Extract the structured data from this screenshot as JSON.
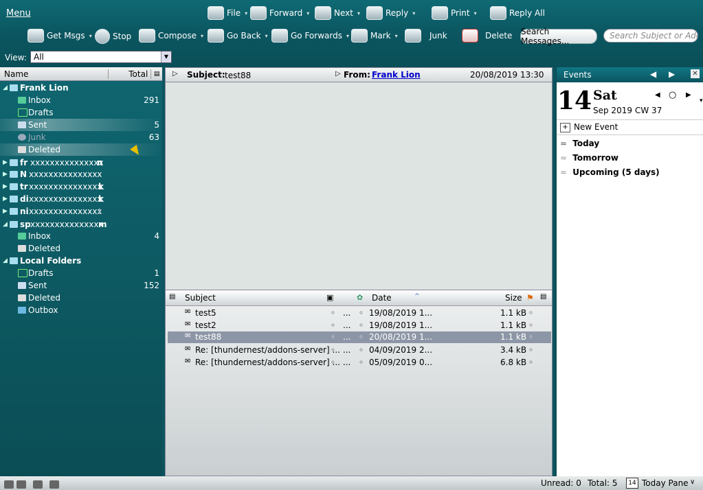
{
  "toolbar": {
    "menu": "Menu",
    "file": "File",
    "forward": "Forward",
    "next": "Next",
    "reply": "Reply",
    "print": "Print",
    "reply_all": "Reply All",
    "get_msgs": "Get Msgs",
    "stop": "Stop",
    "compose": "Compose",
    "go_back": "Go Back",
    "go_forwards": "Go Forwards",
    "mark": "Mark",
    "junk": "Junk",
    "delete": "Delete",
    "search_messages": "Search Messages...",
    "search_placeholder": "Search Subject or Address"
  },
  "view": {
    "label": "View:",
    "value": "All"
  },
  "folder_pane": {
    "header_name": "Name",
    "header_total": "Total",
    "folders": [
      {
        "name": "Frank Lion",
        "count": ""
      },
      {
        "name": "Inbox",
        "count": "291"
      },
      {
        "name": "Drafts",
        "count": ""
      },
      {
        "name": "Sent",
        "count": "5"
      },
      {
        "name": "Junk",
        "count": "63"
      },
      {
        "name": "Deleted",
        "count": ""
      },
      {
        "name": "xxxxxxxxxxxxxxx",
        "count": ""
      },
      {
        "name": "xxxxxxxxxxxxxxx",
        "count": ""
      },
      {
        "name": "xxxxxxxxxxxxxxx",
        "count": ""
      },
      {
        "name": "xxxxxxxxxxxxxxx",
        "count": ""
      },
      {
        "name": "xxxxxxxxxxxxxxx",
        "count": ""
      },
      {
        "name": "xxxxxxxxxxxxxxx",
        "count": ""
      },
      {
        "name": "Inbox",
        "count": "4"
      },
      {
        "name": "Deleted",
        "count": ""
      },
      {
        "name": "Local Folders",
        "count": ""
      },
      {
        "name": "Drafts",
        "count": "1"
      },
      {
        "name": "Sent",
        "count": "152"
      },
      {
        "name": "Deleted",
        "count": ""
      },
      {
        "name": "Outbox",
        "count": ""
      }
    ],
    "account_prefixes": [
      "fr",
      "N",
      "tr",
      "di",
      "ni",
      "sp"
    ],
    "account_suffixes": [
      "n",
      "",
      "k",
      "k",
      "t",
      "m"
    ]
  },
  "message_header": {
    "subject_label": "Subject:",
    "subject": "test88",
    "from_label": "From:",
    "from": "Frank Lion",
    "date": "20/08/2019 13:30"
  },
  "thread_pane": {
    "columns": {
      "subject": "Subject",
      "date": "Date",
      "size": "Size"
    },
    "rows": [
      {
        "subject": "test5",
        "date": "19/08/2019 1...",
        "size": "1.1 kB"
      },
      {
        "subject": "test2",
        "date": "19/08/2019 1...",
        "size": "1.1 kB"
      },
      {
        "subject": "test88",
        "date": "20/08/2019 1...",
        "size": "1.1 kB"
      },
      {
        "subject": "Re: [thundernest/addons-server] ...",
        "date": "04/09/2019 2...",
        "size": "3.4 kB"
      },
      {
        "subject": "Re: [thundernest/addons-server] ...",
        "date": "05/09/2019 0...",
        "size": "6.8 kB"
      }
    ],
    "dots": "..."
  },
  "events": {
    "title": "Events",
    "day_number": "14",
    "weekday": "Sat",
    "month_year": "Sep 2019",
    "calendar_week": "CW 37",
    "new_event": "New Event",
    "today": "Today",
    "tomorrow": "Tomorrow",
    "upcoming": "Upcoming (5 days)"
  },
  "status": {
    "unread": "Unread: 0",
    "total": "Total: 5",
    "today_pane": "Today Pane",
    "today_pane_day": "14"
  },
  "colors": {
    "accent": "#0d5560",
    "selected_row": "#8d96a6",
    "link": "#0000cc"
  }
}
